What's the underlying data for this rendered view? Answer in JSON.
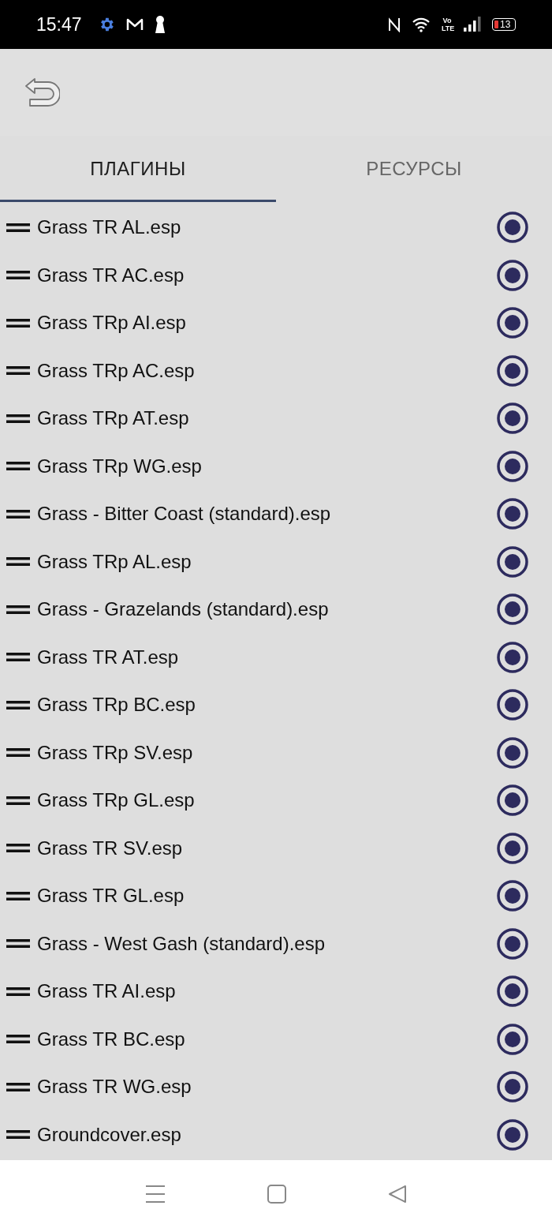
{
  "status_bar": {
    "time": "15:47",
    "volte": "Vo LTE",
    "battery": "13"
  },
  "tabs": [
    {
      "label": "ПЛАГИНЫ",
      "selected": true
    },
    {
      "label": "РЕСУРСЫ",
      "selected": false
    }
  ],
  "plugins": [
    {
      "name": "Grass TR AL.esp",
      "checked": true
    },
    {
      "name": "Grass TR AC.esp",
      "checked": true
    },
    {
      "name": "Grass TRp AI.esp",
      "checked": true
    },
    {
      "name": "Grass TRp AC.esp",
      "checked": true
    },
    {
      "name": "Grass TRp AT.esp",
      "checked": true
    },
    {
      "name": "Grass TRp WG.esp",
      "checked": true
    },
    {
      "name": "Grass - Bitter Coast (standard).esp",
      "checked": true
    },
    {
      "name": "Grass TRp AL.esp",
      "checked": true
    },
    {
      "name": "Grass - Grazelands (standard).esp",
      "checked": true
    },
    {
      "name": "Grass TR AT.esp",
      "checked": true
    },
    {
      "name": "Grass TRp BC.esp",
      "checked": true
    },
    {
      "name": "Grass TRp SV.esp",
      "checked": true
    },
    {
      "name": "Grass TRp GL.esp",
      "checked": true
    },
    {
      "name": "Grass TR SV.esp",
      "checked": true
    },
    {
      "name": "Grass TR GL.esp",
      "checked": true
    },
    {
      "name": "Grass - West Gash (standard).esp",
      "checked": true
    },
    {
      "name": "Grass TR AI.esp",
      "checked": true
    },
    {
      "name": "Grass TR BC.esp",
      "checked": true
    },
    {
      "name": "Grass TR WG.esp",
      "checked": true
    },
    {
      "name": "Groundcover.esp",
      "checked": true
    }
  ]
}
